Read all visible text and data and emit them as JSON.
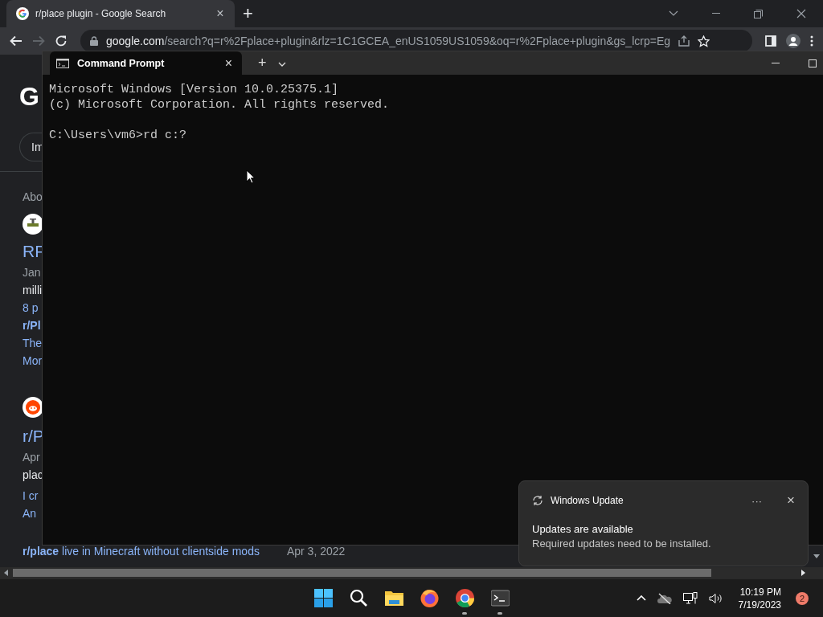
{
  "browser": {
    "tab": {
      "title": "r/place plugin - Google Search",
      "close": "×",
      "selected": true
    },
    "new_tab": "+",
    "address": {
      "host": "google.com",
      "path": "/search?q=r%2Fplace+plugin&rlz=1C1GCEA_enUS1059US1059&oq=r%2Fplace+plugin&gs_lcrp=Eg"
    },
    "forward_disabled": true,
    "page": {
      "logo": "G",
      "chip": "Im",
      "items": [
        {
          "kind": "meta",
          "text": "Abo"
        },
        {
          "kind": "faucet"
        },
        {
          "kind": "heading",
          "text": "RF"
        },
        {
          "kind": "meta",
          "text": "Jan"
        },
        {
          "kind": "text",
          "text": "milli"
        },
        {
          "kind": "link",
          "text": "8 p"
        },
        {
          "kind": "sublink",
          "text": "r/Pl"
        },
        {
          "kind": "link",
          "text": "The"
        },
        {
          "kind": "link",
          "text": "Mor"
        },
        {
          "kind": "reddit"
        },
        {
          "kind": "heading",
          "text": "r/P"
        },
        {
          "kind": "meta",
          "text": "Apr"
        },
        {
          "kind": "text",
          "text": "plac"
        },
        {
          "kind": "link",
          "text": "I cr"
        },
        {
          "kind": "link",
          "text": "An"
        }
      ],
      "result_link": "**r/place** live in Minecraft without clientside mods",
      "result_date": "Apr 3, 2022"
    }
  },
  "terminal": {
    "tab_title": "Command Prompt",
    "close": "×",
    "new_tab": "+",
    "lines": [
      {
        "kind": "output",
        "text": "Microsoft Windows [Version 10.0.25375.1]"
      },
      {
        "kind": "output",
        "text": "(c) Microsoft Corporation. All rights reserved."
      },
      {
        "kind": "prompt",
        "text": "C:\\Users\\vm6>rd c:?"
      }
    ]
  },
  "notification": {
    "app": "Windows Update",
    "more": "···",
    "close": "×",
    "title": "Updates are available",
    "body": "Required updates need to be installed."
  },
  "taskbar": {
    "apps": [
      {
        "kind": "start",
        "running": false
      },
      {
        "kind": "search",
        "running": false
      },
      {
        "kind": "files",
        "running": false
      },
      {
        "kind": "firefox",
        "running": false
      },
      {
        "kind": "chrome",
        "running": true
      },
      {
        "kind": "terminal",
        "running": true
      }
    ],
    "time": "10:19 PM",
    "date": "7/19/2023",
    "badge": "2"
  }
}
